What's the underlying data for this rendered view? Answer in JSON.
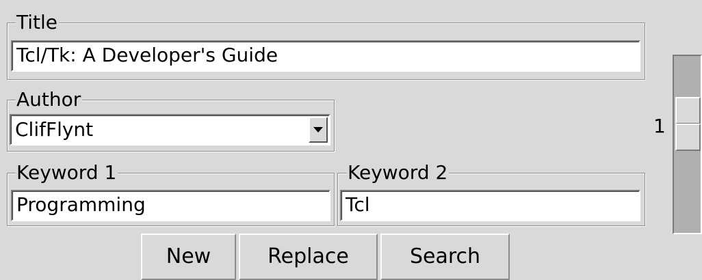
{
  "title_field": {
    "label": "Title",
    "value": "Tcl/Tk: A Developer's Guide"
  },
  "author_field": {
    "label": "Author",
    "value": "ClifFlynt",
    "dropdown_icon": "chevron-down-icon"
  },
  "keyword1_field": {
    "label": "Keyword 1",
    "value": "Programming"
  },
  "keyword2_field": {
    "label": "Keyword 2",
    "value": "Tcl"
  },
  "buttons": {
    "new_label": "New",
    "replace_label": "Replace",
    "search_label": "Search"
  },
  "record_spinner": {
    "value": "1"
  }
}
